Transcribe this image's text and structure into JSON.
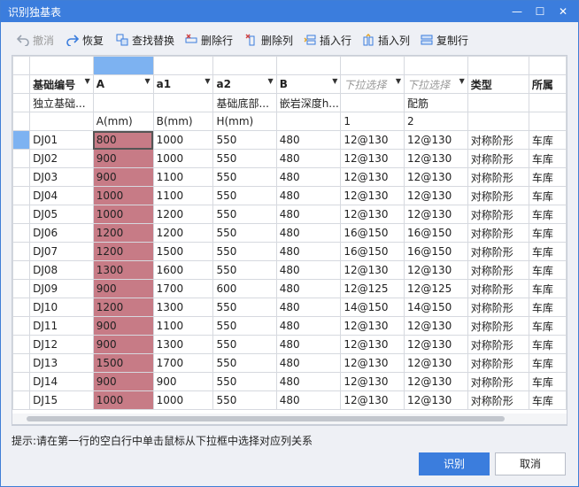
{
  "window": {
    "title": "识别独基表",
    "minimize_glyph": "—",
    "maximize_glyph": "☐",
    "close_glyph": "✕"
  },
  "toolbar": {
    "undo": "撤消",
    "redo": "恢复",
    "find_replace": "查找替换",
    "delete_row": "删除行",
    "delete_col": "删除列",
    "insert_row": "插入行",
    "insert_col": "插入列",
    "copy_row": "复制行"
  },
  "table": {
    "headers": [
      "基础编号",
      "A",
      "a1",
      "a2",
      "B",
      "下拉选择",
      "下拉选择",
      "类型",
      "所属"
    ],
    "subheaders": [
      "独立基础...",
      "",
      "",
      "基础底部...",
      "嵌岩深度h...",
      "",
      "配筋",
      "",
      ""
    ],
    "units": [
      "",
      "A(mm)",
      "B(mm)",
      "H(mm)",
      "",
      "1",
      "2",
      "",
      ""
    ],
    "rows": [
      [
        "DJ01",
        "800",
        "1000",
        "550",
        "480",
        "12@130",
        "12@130",
        "对称阶形",
        "车库"
      ],
      [
        "DJ02",
        "900",
        "1000",
        "550",
        "480",
        "12@130",
        "12@130",
        "对称阶形",
        "车库"
      ],
      [
        "DJ03",
        "900",
        "1100",
        "550",
        "480",
        "12@130",
        "12@130",
        "对称阶形",
        "车库"
      ],
      [
        "DJ04",
        "1000",
        "1100",
        "550",
        "480",
        "12@130",
        "12@130",
        "对称阶形",
        "车库"
      ],
      [
        "DJ05",
        "1000",
        "1200",
        "550",
        "480",
        "12@130",
        "12@130",
        "对称阶形",
        "车库"
      ],
      [
        "DJ06",
        "1200",
        "1200",
        "550",
        "480",
        "16@150",
        "16@150",
        "对称阶形",
        "车库"
      ],
      [
        "DJ07",
        "1200",
        "1500",
        "550",
        "480",
        "16@150",
        "16@150",
        "对称阶形",
        "车库"
      ],
      [
        "DJ08",
        "1300",
        "1600",
        "550",
        "480",
        "12@130",
        "12@130",
        "对称阶形",
        "车库"
      ],
      [
        "DJ09",
        "900",
        "1700",
        "600",
        "480",
        "12@125",
        "12@125",
        "对称阶形",
        "车库"
      ],
      [
        "DJ10",
        "1200",
        "1300",
        "550",
        "480",
        "14@150",
        "14@150",
        "对称阶形",
        "车库"
      ],
      [
        "DJ11",
        "900",
        "1100",
        "550",
        "480",
        "12@130",
        "12@130",
        "对称阶形",
        "车库"
      ],
      [
        "DJ12",
        "900",
        "1300",
        "550",
        "480",
        "12@130",
        "12@130",
        "对称阶形",
        "车库"
      ],
      [
        "DJ13",
        "1500",
        "1700",
        "550",
        "480",
        "12@130",
        "12@130",
        "对称阶形",
        "车库"
      ],
      [
        "DJ14",
        "900",
        "900",
        "550",
        "480",
        "12@130",
        "12@130",
        "对称阶形",
        "车库"
      ],
      [
        "DJ15",
        "1000",
        "1000",
        "550",
        "480",
        "12@130",
        "12@130",
        "对称阶形",
        "车库"
      ]
    ]
  },
  "hint": "提示:请在第一行的空白行中单击鼠标从下拉框中选择对应列关系",
  "buttons": {
    "identify": "识别",
    "cancel": "取消"
  }
}
